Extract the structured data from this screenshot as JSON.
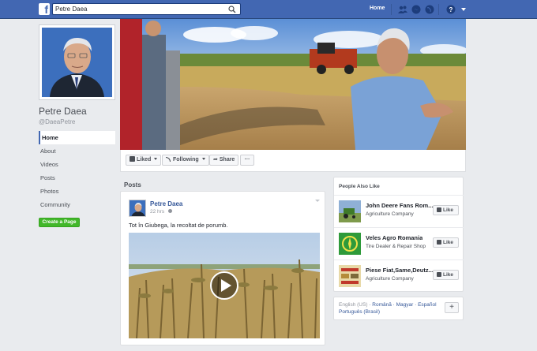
{
  "topbar": {
    "logo": "f",
    "search_value": "Petre Daea",
    "home_label": "Home",
    "icons": [
      "friends-icon",
      "messenger-icon",
      "globe-icon",
      "help-icon"
    ]
  },
  "profile": {
    "name": "Petre Daea",
    "handle": "@DaeaPetre"
  },
  "left_nav": {
    "items": [
      {
        "label": "Home",
        "active": true
      },
      {
        "label": "About"
      },
      {
        "label": "Videos"
      },
      {
        "label": "Posts"
      },
      {
        "label": "Photos"
      },
      {
        "label": "Community"
      }
    ],
    "create_page_label": "Create a Page"
  },
  "actions": {
    "liked": "Liked",
    "following": "Following",
    "share": "Share",
    "more": "···"
  },
  "posts": {
    "heading": "Posts",
    "post": {
      "author": "Petre Daea",
      "time": "22 hrs",
      "text": "Tot în Giubega, la recoltat de porumb."
    }
  },
  "people_also_like": {
    "title": "People Also Like",
    "like_label": "Like",
    "pages": [
      {
        "name": "John Deere Fans Rom...",
        "category": "Agriculture Company"
      },
      {
        "name": "Veles Agro Romania",
        "category": "Tire Dealer & Repair Shop"
      },
      {
        "name": "Piese Fiat,Same,Deutz...",
        "category": "Agriculture Company"
      }
    ]
  },
  "languages": {
    "current": "English (US)",
    "others_line1": [
      "Română",
      "Magyar",
      "Español"
    ],
    "others_line2": [
      "Português (Brasil)"
    ],
    "plus": "+"
  },
  "colors": {
    "brand": "#4267b2",
    "green": "#42b72a",
    "link": "#365899"
  }
}
